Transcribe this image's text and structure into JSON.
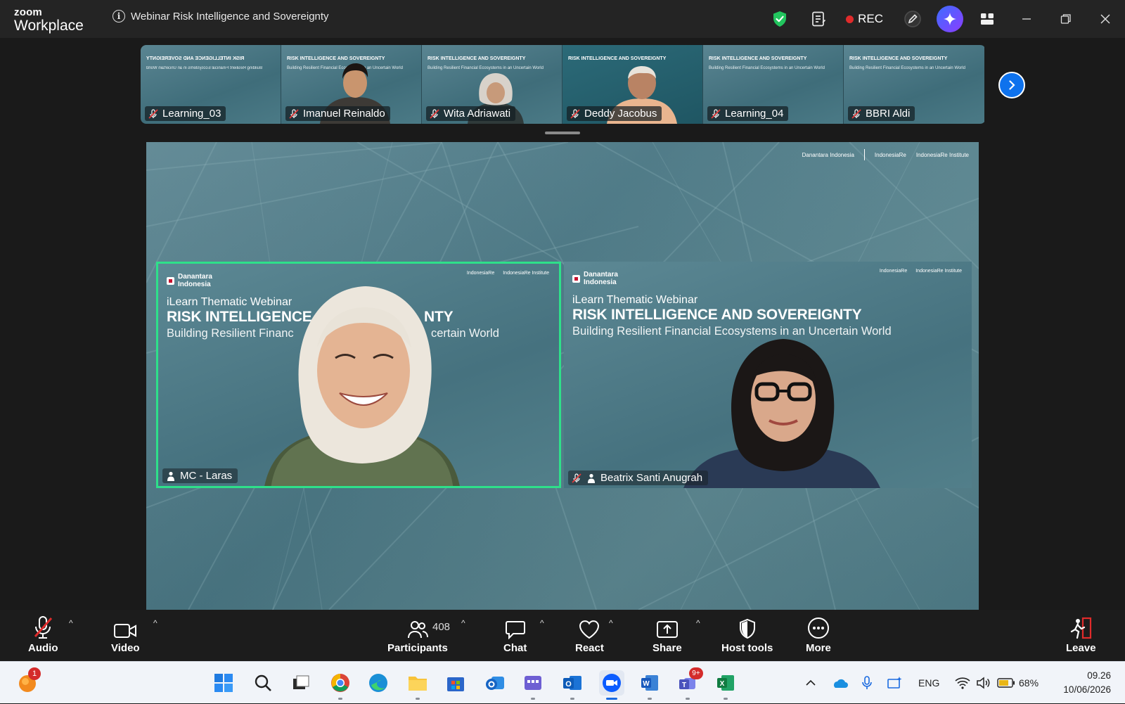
{
  "app": {
    "brand_line1": "zoom",
    "brand_line2": "Workplace",
    "meeting_title": "Webinar Risk Intelligence and Sovereignty",
    "rec_label": "REC"
  },
  "filmstrip": {
    "tiles": [
      {
        "name": "Learning_03"
      },
      {
        "name": "Imanuel Reinaldo"
      },
      {
        "name": "Wita Adriawati"
      },
      {
        "name": "Deddy Jacobus"
      },
      {
        "name": "Learning_04"
      },
      {
        "name": "BBRI Aldi"
      }
    ],
    "mini_title": "RISK INTELLIGENCE AND SOVEREIGNTY",
    "mini_sub": "Building Resilient Financial Ecosystems in an Uncertain World",
    "mini_kicker": "iLearn Thematic Webinar"
  },
  "slide": {
    "brand": "Danantara Indonesia",
    "brand_line1": "Danantara",
    "brand_line2": "Indonesia",
    "logo1": "IndonesiaRe",
    "logo2": "IndonesiaRe Institute",
    "kicker": "iLearn Thematic Webinar",
    "title": "RISK INTELLIGENCE AND SOVEREIGNTY",
    "subtitle": "Building Resilient Financial Ecosystems in an Uncertain World",
    "title_v1": "RISK INTELLIGENCE",
    "title_v1_end": "NTY",
    "sub_v1": "Building Resilient Financ",
    "sub_v1_end": "certain World",
    "footer_v1": "Indonesia Re Institute"
  },
  "videos": [
    {
      "name": "MC - Laras",
      "active_speaker": true
    },
    {
      "name": "Beatrix Santi Anugrah",
      "active_speaker": false
    }
  ],
  "toolbar": {
    "audio": "Audio",
    "video": "Video",
    "participants": "Participants",
    "participants_count": "408",
    "chat": "Chat",
    "react": "React",
    "share": "Share",
    "host_tools": "Host tools",
    "more": "More",
    "leave": "Leave"
  },
  "taskbar": {
    "notification_badge": "1",
    "teams_badge": "9+",
    "language": "ENG",
    "battery": "68%",
    "time": "09.26",
    "date": "10/06/2026"
  },
  "colors": {
    "active_speaker_border": "#2ee08a",
    "accent": "#0e72ed",
    "rec": "#e02b2b"
  }
}
